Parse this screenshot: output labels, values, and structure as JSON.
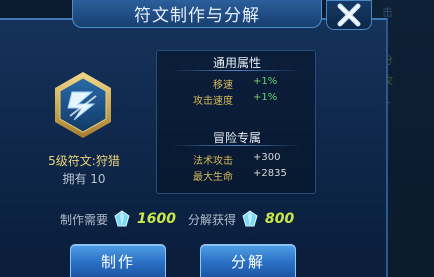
{
  "title": "符文制作与分解",
  "background_texts": [
    "击",
    "分",
    "攻",
    "+"
  ],
  "rune": {
    "name": "5级符文:狩猎",
    "owned": "拥有 10"
  },
  "attributes": {
    "general_title": "通用属性",
    "general": [
      {
        "key": "移速",
        "value": "+1%"
      },
      {
        "key": "攻击速度",
        "value": "+1%"
      }
    ],
    "adventure_title": "冒险专属",
    "adventure": [
      {
        "key": "法术攻击",
        "value": "+300"
      },
      {
        "key": "最大生命",
        "value": "+2835"
      }
    ]
  },
  "cost": {
    "make_label": "制作需要",
    "make_value": "1600",
    "get_label": "分解获得",
    "get_value": "800"
  },
  "buttons": {
    "make": "制作",
    "split": "分解"
  },
  "colors": {
    "gold": "#d6b85c",
    "green": "#6bd26b",
    "cost_number": "#c8e84a",
    "button": "#2a6fc4"
  },
  "icons": {
    "close": "close-icon",
    "gem": "crystal-gem-icon",
    "rune": "rune-emblem-icon"
  }
}
